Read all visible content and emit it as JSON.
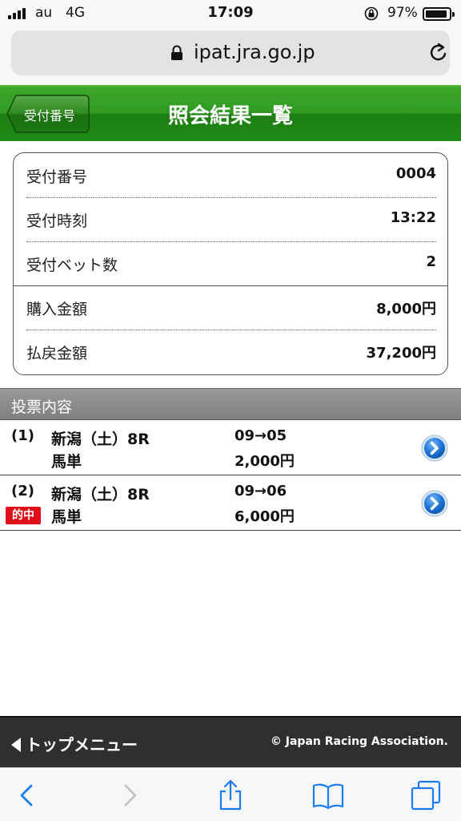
{
  "status_bar": {
    "carrier": "au",
    "network": "4G",
    "time": "17:09",
    "battery_percent": "97%",
    "icons": [
      "signal-icon",
      "orientation-lock-icon",
      "battery-icon"
    ]
  },
  "browser": {
    "url": "ipat.jra.go.jp",
    "icons": [
      "lock-icon",
      "reload-icon"
    ]
  },
  "header": {
    "back_label": "受付番号",
    "title": "照会結果一覧"
  },
  "summary": {
    "rows": [
      {
        "label": "受付番号",
        "value": "0004"
      },
      {
        "label": "受付時刻",
        "value": "13:22"
      },
      {
        "label": "受付ベット数",
        "value": "2"
      },
      {
        "label": "購入金額",
        "value": "8,000円"
      },
      {
        "label": "払戻金額",
        "value": "37,200円"
      }
    ]
  },
  "section": {
    "title": "投票内容"
  },
  "bets": [
    {
      "number": "(1)",
      "race": "新潟（土）8R",
      "bet_type": "馬単",
      "combination": "09→05",
      "amount": "2,000円",
      "hit": false
    },
    {
      "number": "(2)",
      "race": "新潟（土）8R",
      "bet_type": "馬単",
      "combination": "09→06",
      "amount": "6,000円",
      "hit": true,
      "hit_label": "的中"
    }
  ],
  "footer": {
    "top_menu": "トップメニュー",
    "copyright": "© Japan Racing Association."
  },
  "toolbar": {
    "icons": [
      "back-icon",
      "forward-icon",
      "share-icon",
      "bookmarks-icon",
      "tabs-icon"
    ]
  },
  "colors": {
    "header_green": "#2f9a22",
    "hit_red": "#e0101a",
    "arrow_blue": "#1a6fd0",
    "safari_blue": "#1a7cf5"
  }
}
